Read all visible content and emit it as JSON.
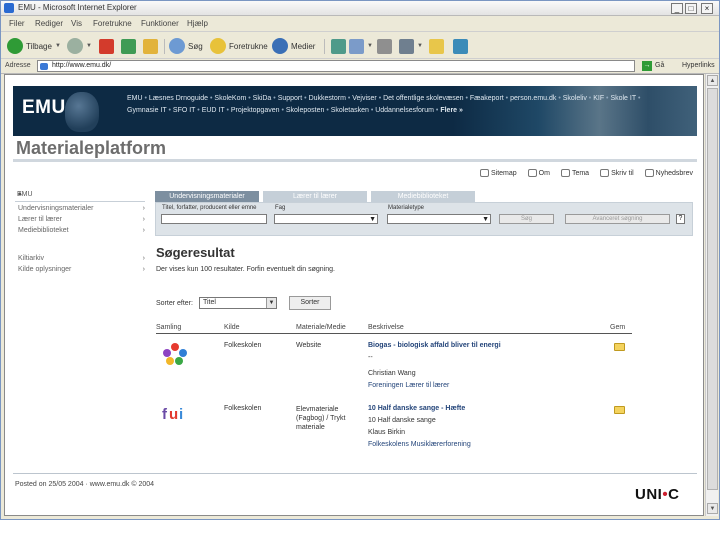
{
  "window": {
    "title": "EMU - Microsoft Internet Explorer",
    "controls": [
      "_",
      "□",
      "×"
    ]
  },
  "menu": [
    "Filer",
    "Rediger",
    "Vis",
    "Foretrukne",
    "Funktioner",
    "Hjælp"
  ],
  "toolbar": {
    "back": "Tilbage",
    "search": "Søg",
    "favorites": "Foretrukne",
    "media": "Medier"
  },
  "address": {
    "label": "Adresse",
    "url": "http://www.emu.dk/",
    "go": "Gå",
    "links": "Hyperlinks"
  },
  "banner": {
    "logo": "EMU",
    "links": [
      "EMU",
      "Læsnes Drnoguide",
      "SkoleKom",
      "SkiDa",
      "Support",
      "Dukkestorm",
      "Vejviser",
      "Det offentlige skolevæsen",
      "Fæakeport",
      "person.emu.dk",
      "Skoleliv",
      "KIF",
      "Skole IT",
      "Gymnasie IT",
      "SFO IT",
      "EUD IT",
      "Projektopgaven",
      "Skoleposten",
      "Skoletasken",
      "Uddannelsesforum"
    ],
    "more": "Flere »"
  },
  "page_title": "Materialeplatform",
  "utility": [
    "Sitemap",
    "Om",
    "Tema",
    "Skriv til",
    "Nyhedsbrev"
  ],
  "sidebar": {
    "header": "EMU",
    "items": [
      "Undervisningsmaterialer",
      "Lærer til lærer",
      "Mediebiblioteket"
    ],
    "items2": [
      "Kiltiarkiv",
      "Kilde oplysninger"
    ]
  },
  "search": {
    "tabs": [
      "Undervisningsmaterialer",
      "Lærer til lærer",
      "Mediebiblioteket"
    ],
    "labels": [
      "Titel, forfatter, producent eller emne",
      "Fag",
      "Materialetype"
    ],
    "search_button": "Søg",
    "advanced_button": "Avanceret søgning",
    "help": "?"
  },
  "results": {
    "heading": "Søgeresultat",
    "info": "Der vises kun 100 resultater. Forfin eventuelt din søgning.",
    "sort_label": "Sorter efter:",
    "sort_value": "Titel",
    "sort_button": "Sorter",
    "columns": [
      "Samling",
      "Kilde",
      "Materiale/Medie",
      "Beskrivelse",
      "Gem"
    ],
    "rows": [
      {
        "collection_icon": "flower-icon",
        "source": "Folkeskolen",
        "medium": "Website",
        "title": "Biogas - biologisk affald bliver til energi",
        "lines": [
          "--",
          "Christian Wang"
        ],
        "link": "Foreningen Lærer til lærer"
      },
      {
        "collection_icon": "fui-icon",
        "source": "Folkeskolen",
        "medium": "Elevmateriale (Fagbog) / Trykt materiale",
        "title": "10 Half danske sange - Hæfte",
        "lines": [
          "10 Half danske sange",
          "Klaus Birkin"
        ],
        "link": "Folkeskolens Musiklærerforening"
      }
    ]
  },
  "footer": {
    "text": "Posted on 25/05 2004 · www.emu.dk © 2004",
    "logo_left": "UNI",
    "logo_dot": "•",
    "logo_right": "C"
  },
  "colors": {
    "banner": "#0d2a44",
    "link": "#24457a",
    "tab": "#7d8fa0",
    "panel": "#dde3e8",
    "logo_dot": "#cc1f2f"
  }
}
